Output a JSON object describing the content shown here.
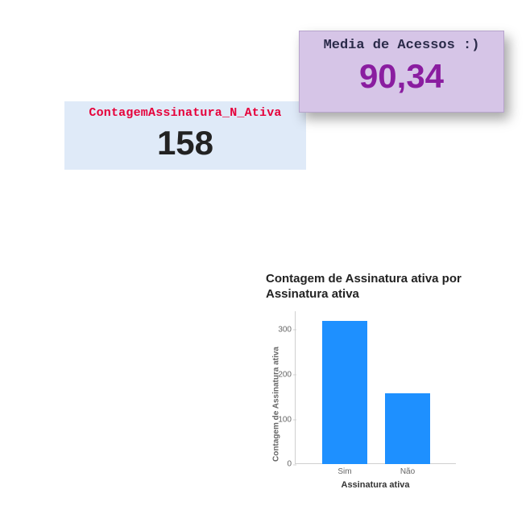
{
  "card_blue": {
    "title": "ContagemAssinatura_N_Ativa",
    "value": "158"
  },
  "card_purple": {
    "title": "Media de Acessos :)",
    "value": "90,34"
  },
  "chart_data": {
    "type": "bar",
    "title": "Contagem de Assinatura ativa por Assinatura ativa",
    "xlabel": "Assinatura ativa",
    "ylabel": "Contagem de Assinatura ativa",
    "categories": [
      "Sim",
      "Não"
    ],
    "values": [
      320,
      158
    ],
    "ylim": [
      0,
      340
    ],
    "yticks": [
      0,
      100,
      200,
      300
    ],
    "bar_color": "#1e90ff"
  }
}
